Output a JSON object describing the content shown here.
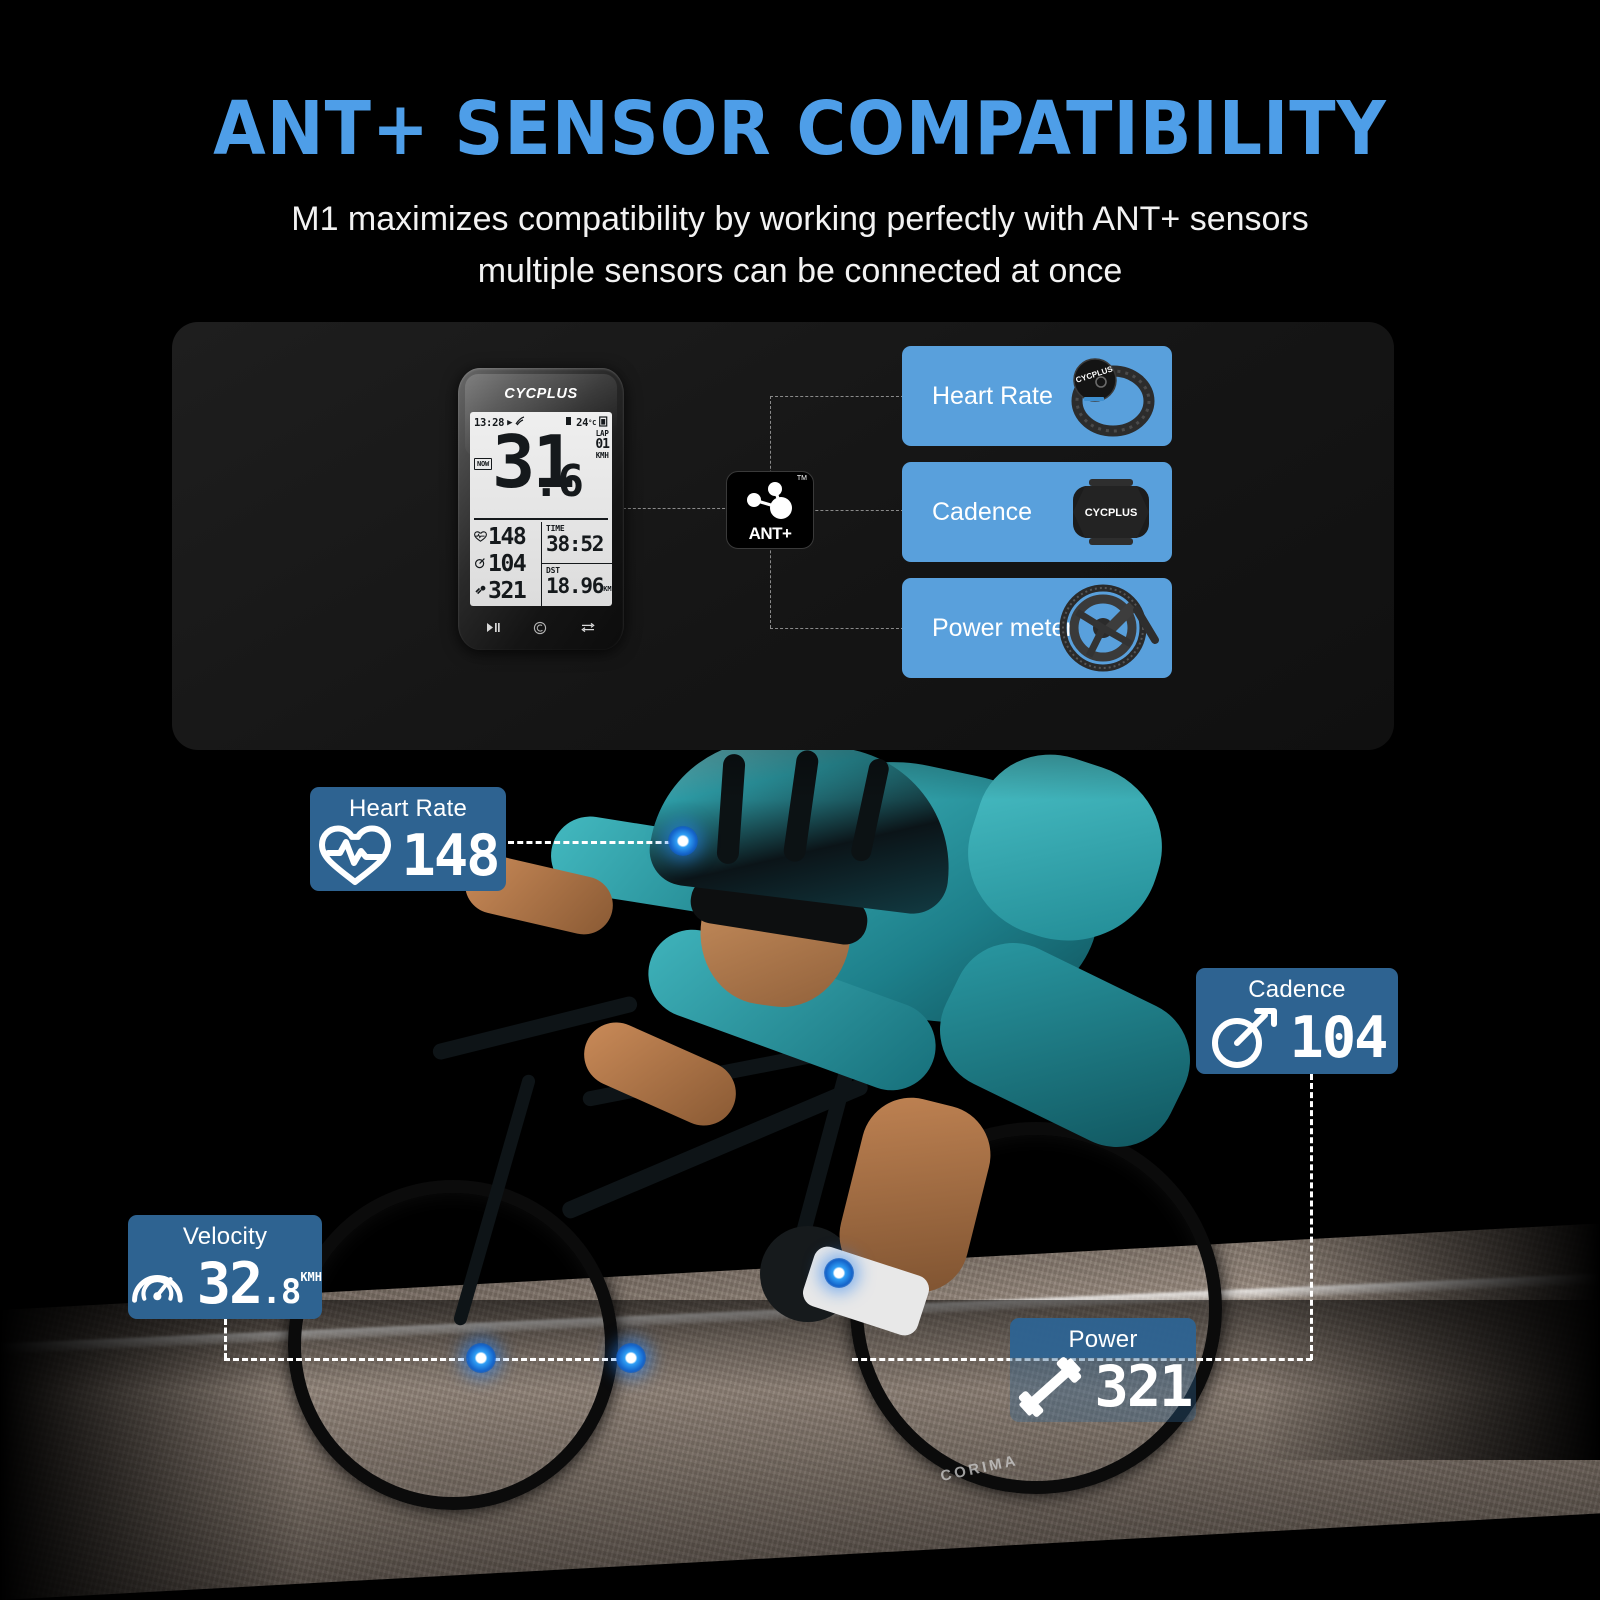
{
  "header": {
    "title": "ANT+ SENSOR COMPATIBILITY",
    "subtitle_line1": "M1 maximizes compatibility by working perfectly with ANT+ sensors",
    "subtitle_line2": "multiple sensors can be connected at once",
    "title_color": "#4e9ee8"
  },
  "device": {
    "brand": "CYCPLUS",
    "status": {
      "time": "13:28",
      "play_icon": "▶",
      "gps_icon": "gps-signal-icon",
      "signal_icon": "signal-bars-icon",
      "temperature": "24",
      "temperature_unit": "°C",
      "battery_icon": "battery-icon"
    },
    "main": {
      "now_label": "NOW",
      "speed_integer": "31",
      "speed_decimal": ".6",
      "lap_label": "LAP",
      "lap_value": "01",
      "speed_unit": "KMH"
    },
    "metrics": [
      {
        "icon": "heart-icon",
        "value": "148"
      },
      {
        "icon": "cadence-icon",
        "value": "104"
      },
      {
        "icon": "power-icon",
        "value": "321"
      }
    ],
    "cells": [
      {
        "label": "TIME",
        "value": "38:52",
        "unit": ""
      },
      {
        "label": "DST",
        "value": "18.96",
        "unit": "KM"
      }
    ],
    "buttons": [
      {
        "icon": "play-pause-icon",
        "glyph": "▶‖"
      },
      {
        "icon": "lap-circle-icon",
        "glyph": "ⓒ"
      },
      {
        "icon": "page-loop-icon",
        "glyph": "⇄"
      }
    ]
  },
  "ant_logo": {
    "text": "ANT+",
    "trademark": "TM",
    "icon": "ant-plus-molecule-icon"
  },
  "sensor_cards": [
    {
      "label": "Heart Rate",
      "image": "heart-rate-armband-image",
      "brand": "CYCPLUS"
    },
    {
      "label": "Cadence",
      "image": "cadence-sensor-image",
      "brand": "CYCPLUS"
    },
    {
      "label": "Power meter",
      "image": "power-meter-crankset-image",
      "brand": ""
    }
  ],
  "badges": [
    {
      "id": "heart-rate",
      "caption": "Heart Rate",
      "value": "148",
      "unit": "",
      "icon": "heart-pulse-icon"
    },
    {
      "id": "cadence",
      "caption": "Cadence",
      "value": "104",
      "unit": "",
      "icon": "crank-arm-icon"
    },
    {
      "id": "velocity",
      "caption": "Velocity",
      "value": "32",
      "decimal": ".8",
      "unit": "KMH",
      "icon": "speedometer-icon"
    },
    {
      "id": "power",
      "caption": "Power",
      "value": "321",
      "unit": "",
      "icon": "dumbbell-icon"
    }
  ],
  "colors": {
    "accent_blue": "#4e9ee8",
    "card_blue": "#59a0dc",
    "badge_blue": "#2e6391",
    "background": "#000000",
    "panel": "#1a1a1a"
  }
}
